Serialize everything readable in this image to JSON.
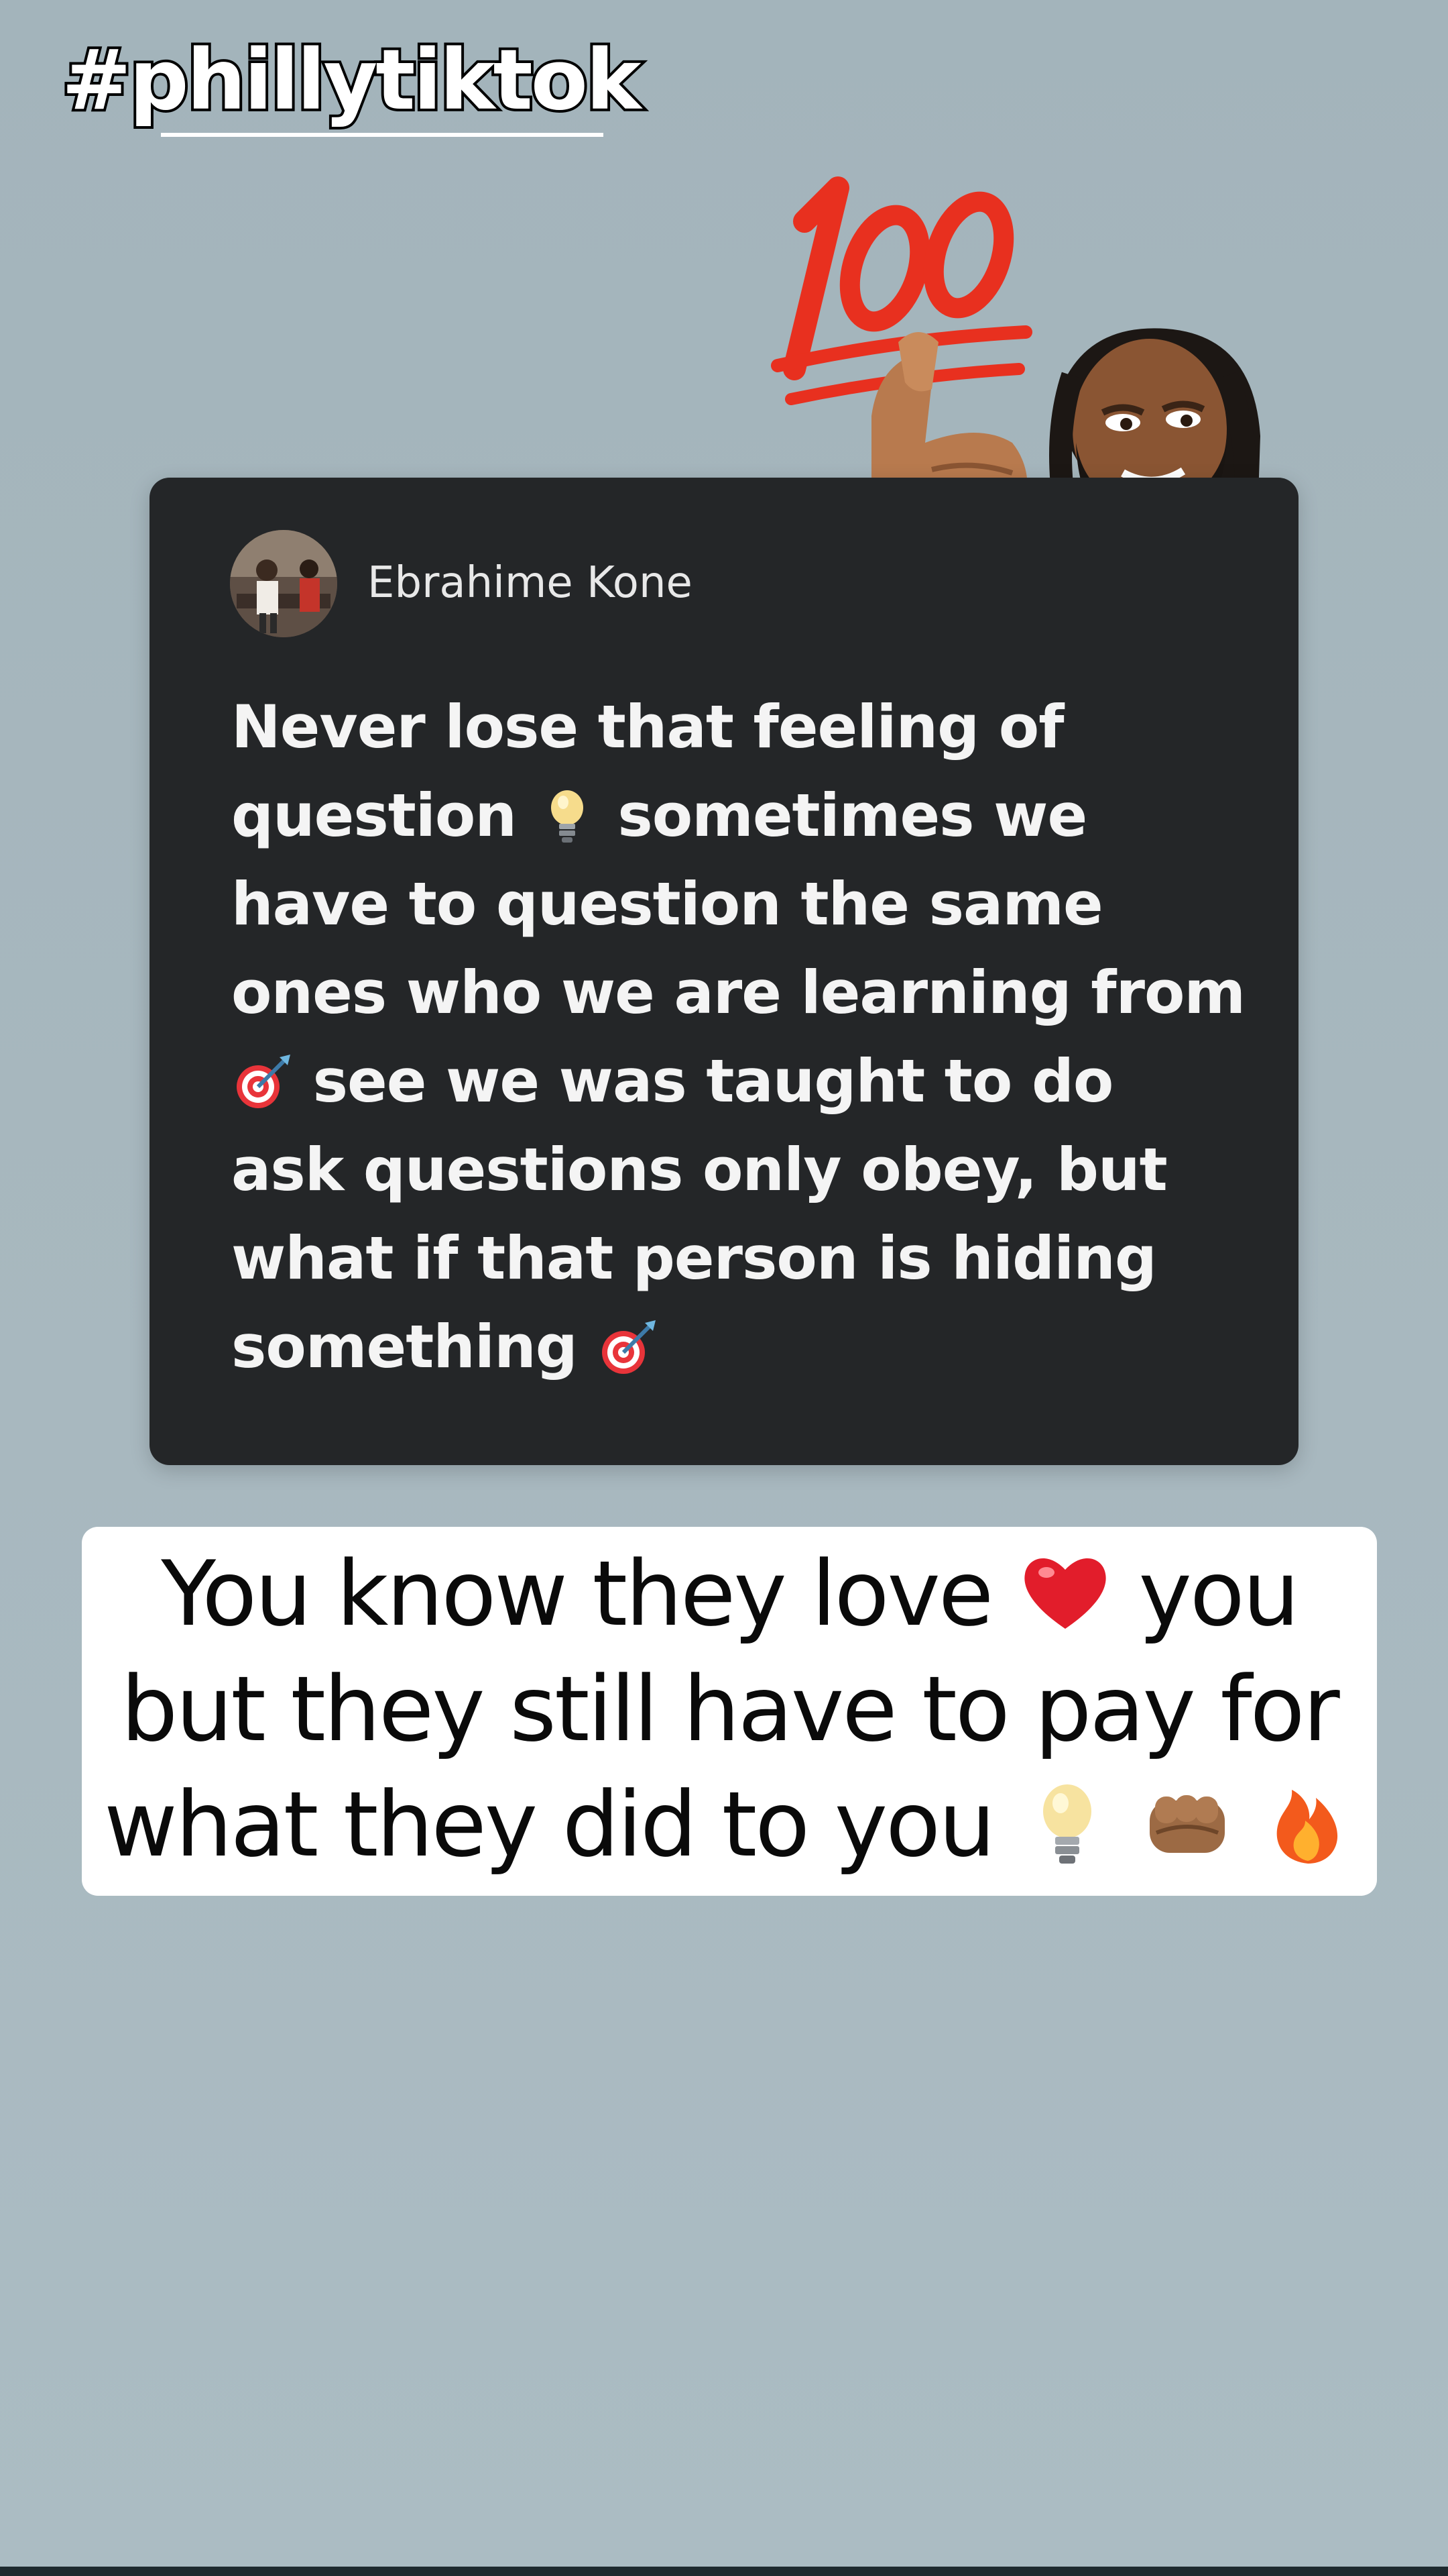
{
  "hashtag": "#phillytiktok",
  "stickers": {
    "hundred": "hundred-points-emoji",
    "avatar": "thumbs-up-avatar"
  },
  "comment": {
    "author": "Ebrahime Kone",
    "lines": {
      "l1": "Never lose that feeling of",
      "l2a": "question",
      "l2b": "sometimes we",
      "l3": "have to question the same",
      "l4": "ones who we are learning from",
      "l5": "see we was taught to do",
      "l6": "ask questions only obey, but",
      "l7": "what if that person  is hiding",
      "l8": "something"
    }
  },
  "caption": {
    "l1a": "You know they love",
    "l1b": "you",
    "l2": "but they still have to pay for",
    "l3": "what they did to you"
  },
  "colors": {
    "background": "#a5b6bd",
    "card": "#242628",
    "hundred_red": "#e8301f"
  }
}
